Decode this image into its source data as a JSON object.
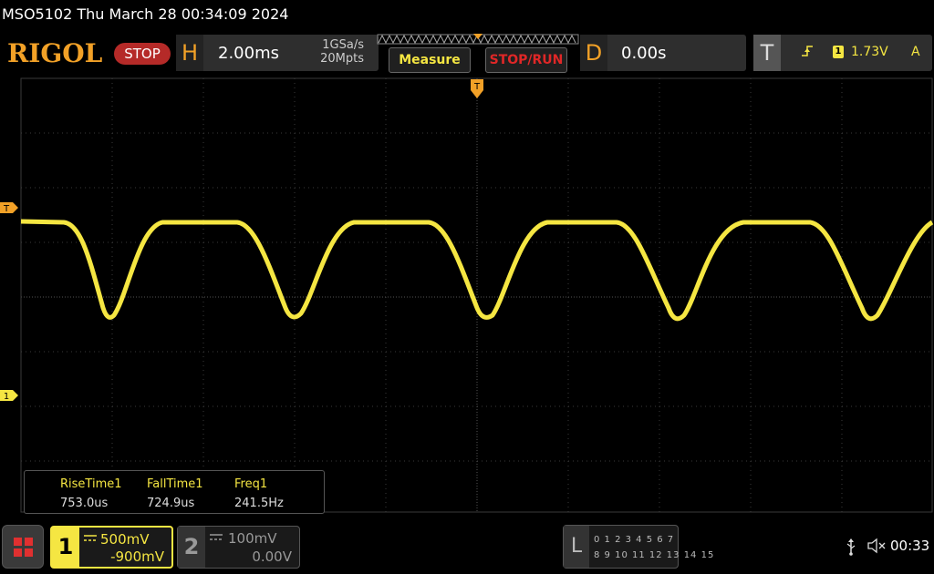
{
  "titlebar": {
    "text": "MSO5102  Thu March 28 00:34:09 2024"
  },
  "header": {
    "logo": "RIGOL",
    "run_state": "STOP",
    "horizontal": {
      "letter": "H",
      "timebase": "2.00ms",
      "sample_rate": "1GSa/s",
      "memory_depth": "20Mpts"
    },
    "measure_label": "Measure",
    "stoprun_label": "STOP/RUN",
    "delay": {
      "letter": "D",
      "value": "0.00s"
    },
    "trigger": {
      "letter": "T",
      "slope_icon": "rising-edge-icon",
      "source": "1",
      "level": "1.73V",
      "mode": "A"
    }
  },
  "markers": {
    "trigger_level": "T",
    "channel1": "1"
  },
  "measurements": {
    "items": [
      {
        "name": "RiseTime1",
        "value": "753.0us"
      },
      {
        "name": "FallTime1",
        "value": "724.9us"
      },
      {
        "name": "Freq1",
        "value": "241.5Hz"
      }
    ]
  },
  "channels": {
    "ch1": {
      "number": "1",
      "scale": "500mV",
      "offset": "-900mV",
      "color": "#f5e642",
      "active": true
    },
    "ch2": {
      "number": "2",
      "scale": "100mV",
      "offset": "0.00V",
      "color": "#999999",
      "active": false
    }
  },
  "logic": {
    "letter": "L",
    "row1": "0 1 2 3  4 5 6 7",
    "row2": "8 9 10 11 12 13 14 15"
  },
  "status": {
    "clock": "00:33"
  },
  "colors": {
    "accent": "#f2a127",
    "trace": "#f5e642",
    "stop": "#b52a28",
    "grid": "#3a3a3a"
  }
}
